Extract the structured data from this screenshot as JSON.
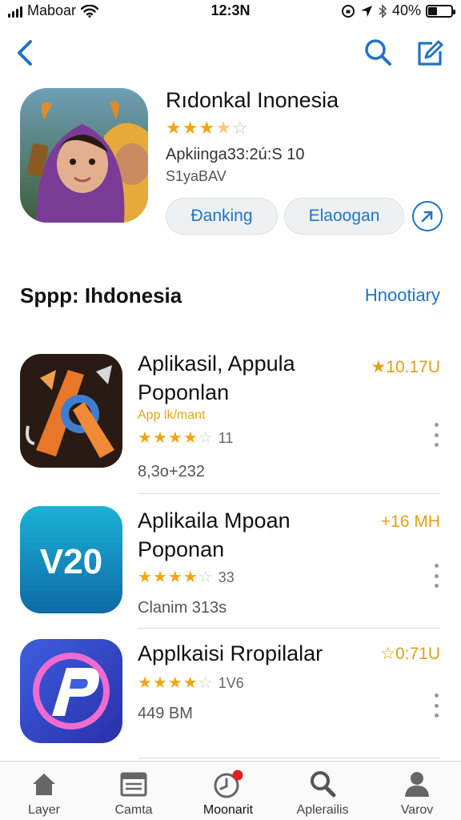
{
  "status_bar": {
    "carrier": "Maboar",
    "time": "12:3Ν",
    "battery_percent": "40%",
    "battery_level": 0.4
  },
  "nav": {
    "back_icon": "chevron-left-icon",
    "search_icon": "search-icon",
    "compose_icon": "compose-icon"
  },
  "hero": {
    "title": "Rıdonkal Inonesia",
    "rating_stars": 3.5,
    "meta_line1": "Apkiinga33:2ú:S 10",
    "meta_line2": "S1yaBAV",
    "button_primary": "Đanking",
    "button_secondary": "Elaoogan",
    "share_icon": "share-arrow-icon"
  },
  "section": {
    "title": "Sppp: Ihdonesia",
    "link": "Hnootiary"
  },
  "apps": [
    {
      "name_line1": "Aplikasil, Appula",
      "name_line2": "Poponlan",
      "subtitle": "App lk/mant",
      "rating": 4,
      "rating_count": "11",
      "meta": "8,3o+232",
      "price": "★10.17U",
      "icon": "orange-tool-icon"
    },
    {
      "name_line1": "Aplikaila Mpoan",
      "name_line2": "Poponan",
      "subtitle": "",
      "rating": 4,
      "rating_count": "33",
      "meta": "Clanim 313s",
      "price": "+16 MH",
      "icon": "v20-icon",
      "icon_text": "V20"
    },
    {
      "name_line1": "Applkaisi Rropilalar",
      "name_line2": "",
      "subtitle": "",
      "rating": 4,
      "rating_count": "1V6",
      "meta": "449 BM",
      "price": "☆0:71U",
      "icon": "p-logo-icon"
    }
  ],
  "tabs": [
    {
      "label": "Layer",
      "icon": "home-icon"
    },
    {
      "label": "Camta",
      "icon": "calendar-icon"
    },
    {
      "label": "Moonarit",
      "icon": "clock-badge-icon"
    },
    {
      "label": "Aplerailis",
      "icon": "search-icon"
    },
    {
      "label": "Varov",
      "icon": "person-icon"
    }
  ],
  "colors": {
    "accent_blue": "#1f73c4",
    "star_gold": "#f0a516",
    "price_gold": "#e0a015",
    "badge_red": "#e02020"
  }
}
